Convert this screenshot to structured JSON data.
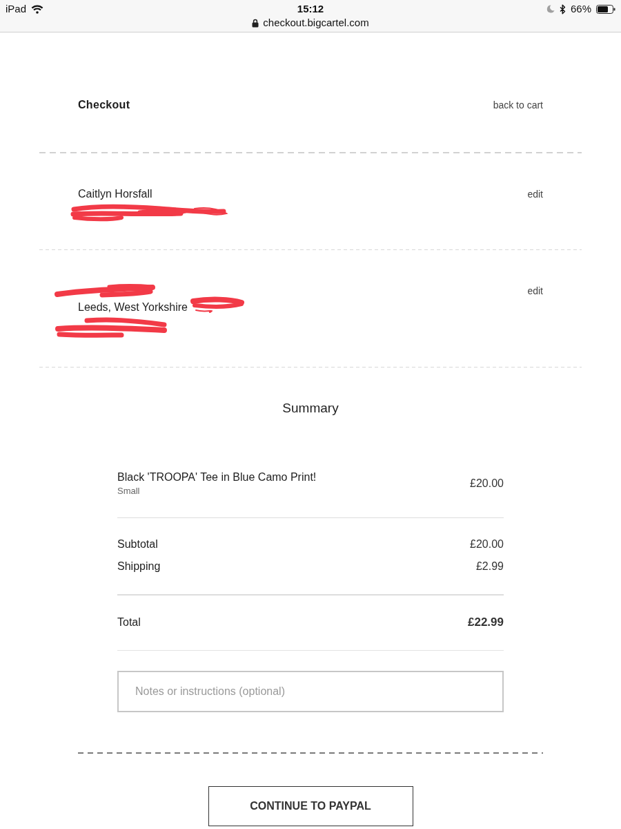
{
  "status_bar": {
    "device": "iPad",
    "time": "15:12",
    "url": "checkout.bigcartel.com",
    "battery": "66%"
  },
  "header": {
    "title": "Checkout",
    "back_link": "back to cart"
  },
  "contact_blocks": [
    {
      "lines": [
        {
          "kind": "text",
          "text": "Caitlyn Horsfall",
          "scribbled_tail": false
        },
        {
          "kind": "scribbled"
        }
      ],
      "action": "edit"
    },
    {
      "lines": [
        {
          "kind": "scribbled"
        },
        {
          "kind": "text",
          "text": "Leeds, West Yorkshire",
          "scribbled_tail": true
        },
        {
          "kind": "scribbled"
        }
      ],
      "action": "edit"
    }
  ],
  "summary": {
    "title": "Summary",
    "items": [
      {
        "name": "Black 'TROOPA' Tee in Blue Camo Print!",
        "option": "Small",
        "price": "£20.00"
      }
    ],
    "costs": [
      {
        "label": "Subtotal",
        "value": "£20.00"
      },
      {
        "label": "Shipping",
        "value": "£2.99"
      }
    ],
    "total": {
      "label": "Total",
      "value": "£22.99"
    }
  },
  "notes": {
    "placeholder": "Notes or instructions (optional)"
  },
  "button": {
    "label": "CONTINUE TO PAYPAL"
  }
}
